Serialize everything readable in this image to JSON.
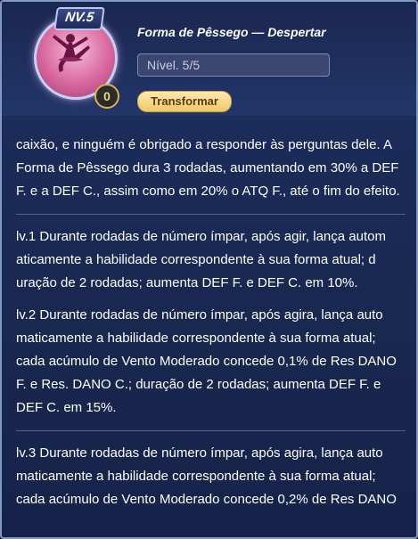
{
  "header": {
    "level_tag": "NV.5",
    "level_badge": "0",
    "title": "Forma de Pêssego — Despertar",
    "level_field": "Nível. 5/5",
    "transform_label": "Transformar"
  },
  "content": {
    "intro": "caixão, e ninguém é obrigado a responder às perguntas dele. A Forma de Pêssego dura 3 rodadas, aumentando em 30% a DEF F. e a DEF C., assim como em 20% o ATQ F., até o fim do efeito.",
    "lv1": "lv.1 Durante rodadas de número ímpar, após agir, lança autom aticamente a habilidade correspondente à sua forma atual; d uração de 2 rodadas; aumenta DEF F. e DEF C. em 10%.",
    "lv2": "lv.2 Durante rodadas de número ímpar, após agira, lança auto maticamente a habilidade correspondente à sua forma atual; cada acúmulo de Vento Moderado concede 0,1% de Res DANO F. e Res. DANO C.; duração de 2 rodadas; aumenta DEF F. e DEF C. em 15%.",
    "lv3": "lv.3 Durante rodadas de número ímpar, após agira, lança auto maticamente a habilidade correspondente à sua forma atual; cada acúmulo de Vento Moderado concede 0,2% de Res DANO"
  },
  "colors": {
    "panel_bg": "#1c2c5c",
    "accent_gold": "#f1c866",
    "emblem_pink": "#d9679f"
  }
}
